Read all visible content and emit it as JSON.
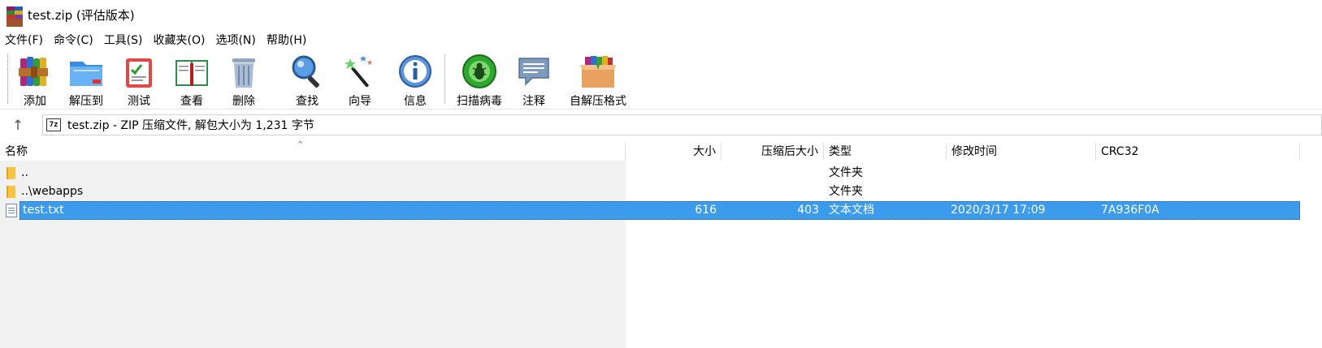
{
  "window": {
    "title": "test.zip (评估版本)",
    "icon": "winrar-books-icon"
  },
  "menu": [
    {
      "label": "文件(F)"
    },
    {
      "label": "命令(C)"
    },
    {
      "label": "工具(S)"
    },
    {
      "label": "收藏夹(O)"
    },
    {
      "label": "选项(N)"
    },
    {
      "label": "帮助(H)"
    }
  ],
  "toolbar": [
    {
      "label": "添加",
      "icon": "add-archive-icon"
    },
    {
      "label": "解压到",
      "icon": "extract-to-icon"
    },
    {
      "label": "测试",
      "icon": "test-icon"
    },
    {
      "label": "查看",
      "icon": "view-book-icon"
    },
    {
      "label": "删除",
      "icon": "trash-icon"
    },
    {
      "label": "查找",
      "icon": "magnifier-icon"
    },
    {
      "label": "向导",
      "icon": "wizard-wand-icon"
    },
    {
      "label": "信息",
      "icon": "info-icon"
    },
    {
      "label": "扫描病毒",
      "icon": "virus-scan-icon"
    },
    {
      "label": "注释",
      "icon": "comment-icon"
    },
    {
      "label": "自解压格式",
      "icon": "sfx-box-icon"
    }
  ],
  "address": {
    "up_icon": "up-arrow-icon",
    "archive_badge": "7z",
    "text": "test.zip - ZIP 压缩文件, 解包大小为 1,231 字节"
  },
  "columns": {
    "name": "名称",
    "size": "大小",
    "packed": "压缩后大小",
    "type": "类型",
    "modified": "修改时间",
    "crc": "CRC32"
  },
  "rows": [
    {
      "name": "..",
      "size": "",
      "packed": "",
      "type": "文件夹",
      "modified": "",
      "crc": "",
      "icon": "folder-icon"
    },
    {
      "name": "..\\webapps",
      "size": "",
      "packed": "",
      "type": "文件夹",
      "modified": "",
      "crc": "",
      "icon": "folder-icon"
    },
    {
      "name": "test.txt",
      "size": "616",
      "packed": "403",
      "type": "文本文档",
      "modified": "2020/3/17 17:09",
      "crc": "7A936F0A",
      "icon": "text-file-icon",
      "selected": true
    }
  ],
  "colors": {
    "selection": "#3c9bea",
    "list_background": "#f1f1f1"
  }
}
